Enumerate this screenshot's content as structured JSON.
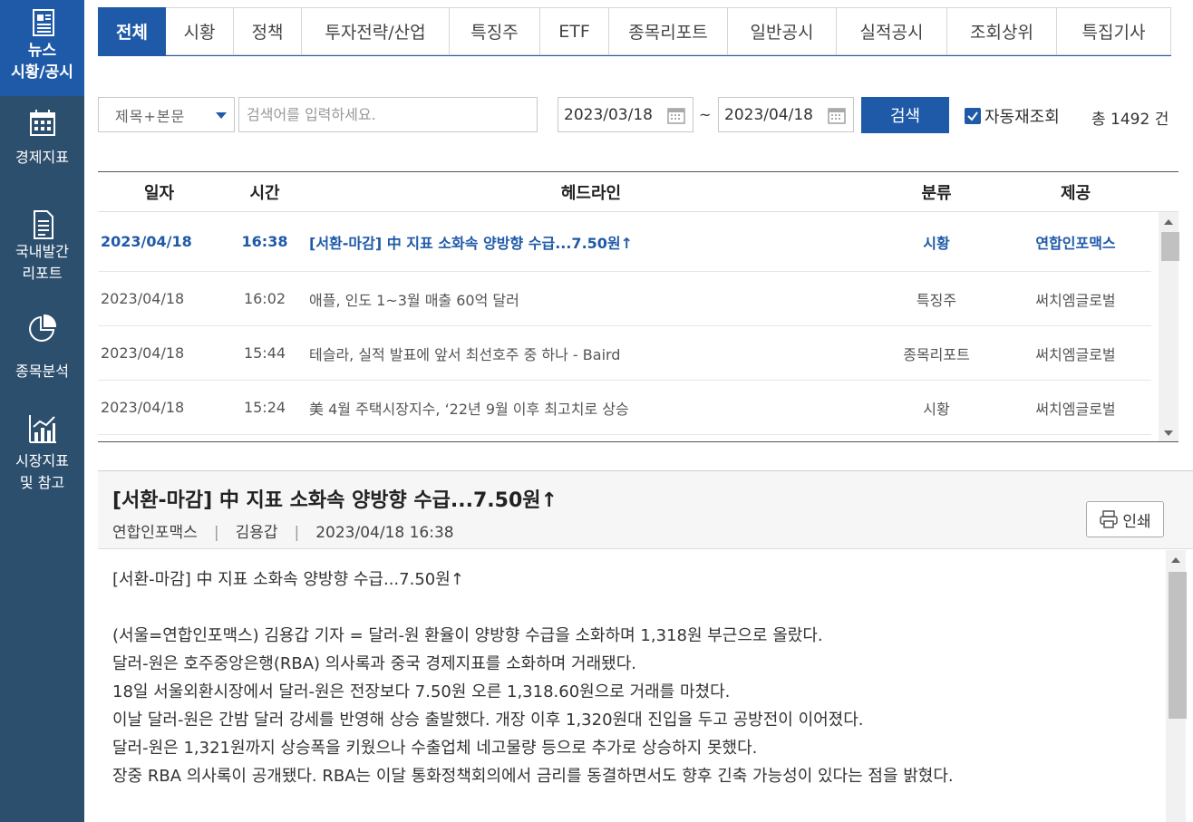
{
  "sidebar": {
    "items": [
      {
        "label1": "뉴스",
        "label2": "시황/공시",
        "icon": "newspaper-icon"
      },
      {
        "label1": "경제지표",
        "label2": "",
        "icon": "calendar-icon"
      },
      {
        "label1": "국내발간",
        "label2": "리포트",
        "icon": "document-icon"
      },
      {
        "label1": "종목분석",
        "label2": "",
        "icon": "pie-chart-icon"
      },
      {
        "label1": "시장지표",
        "label2": "및 참고",
        "icon": "bar-chart-icon"
      }
    ]
  },
  "tabs": [
    "전체",
    "시황",
    "정책",
    "투자전략/산업",
    "특징주",
    "ETF",
    "종목리포트",
    "일반공시",
    "실적공시",
    "조회상위",
    "특집기사"
  ],
  "search": {
    "scope": "제목+본문",
    "placeholder": "검색어를 입력하세요.",
    "date_from": "2023/03/18",
    "date_to": "2023/04/18",
    "tilde": "~",
    "button": "검색",
    "auto_label": "자동재조회",
    "total": "총 1492 건"
  },
  "table": {
    "headers": {
      "date": "일자",
      "time": "시간",
      "headline": "헤드라인",
      "category": "분류",
      "provider": "제공"
    },
    "rows": [
      {
        "date": "2023/04/18",
        "time": "16:38",
        "headline": "[서환-마감] 中 지표 소화속 양방향 수급...7.50원↑",
        "category": "시황",
        "provider": "연합인포맥스"
      },
      {
        "date": "2023/04/18",
        "time": "16:02",
        "headline": "애플, 인도 1~3월 매출 60억 달러",
        "category": "특징주",
        "provider": "써치엠글로벌"
      },
      {
        "date": "2023/04/18",
        "time": "15:44",
        "headline": "테슬라, 실적 발표에 앞서 최선호주 중 하나 - Baird",
        "category": "종목리포트",
        "provider": "써치엠글로벌"
      },
      {
        "date": "2023/04/18",
        "time": "15:24",
        "headline": "美 4월 주택시장지수, ‘22년 9월 이후 최고치로 상승",
        "category": "시황",
        "provider": "써치엠글로벌"
      }
    ]
  },
  "article": {
    "title": "[서환-마감] 中 지표 소화속 양방향 수급...7.50원↑",
    "provider": "연합인포맥스",
    "author": "김용갑",
    "datetime": "2023/04/18 16:38",
    "print_label": "인쇄",
    "body": {
      "line0": "[서환-마감] 中 지표 소화속 양방향 수급...7.50원↑",
      "line1": "(서울=연합인포맥스) 김용갑 기자 = 달러-원 환율이 양방향 수급을 소화하며 1,318원 부근으로 올랐다.",
      "line2": "달러-원은 호주중앙은행(RBA) 의사록과 중국 경제지표를 소화하며 거래됐다.",
      "line3": "18일 서울외환시장에서 달러-원은 전장보다 7.50원 오른 1,318.60원으로 거래를 마쳤다.",
      "line4": "이날 달러-원은 간밤 달러 강세를 반영해 상승 출발했다. 개장 이후 1,320원대 진입을 두고 공방전이 이어졌다.",
      "line5": "달러-원은 1,321원까지 상승폭을 키웠으나 수출업체 네고물량 등으로 추가로 상승하지 못했다.",
      "line6": "장중 RBA 의사록이 공개됐다. RBA는 이달 통화정책회의에서 금리를 동결하면서도 향후 긴축 가능성이 있다는 점을 밝혔다."
    }
  },
  "colors": {
    "accent": "#1f5aa8",
    "sidebar": "#2d4f6e"
  }
}
